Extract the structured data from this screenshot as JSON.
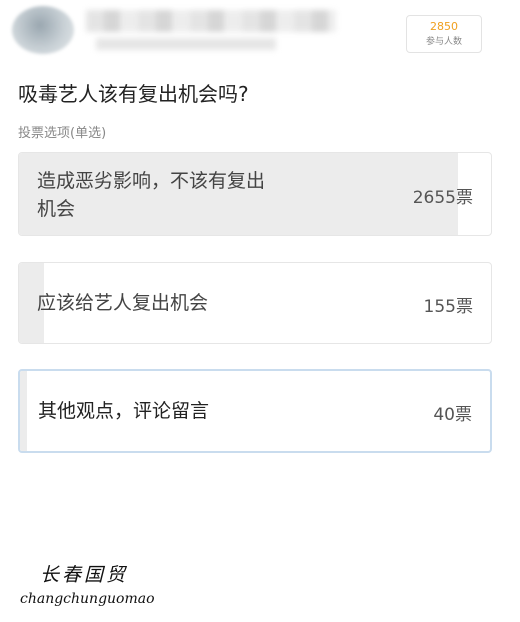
{
  "header": {
    "participants_count": "2850",
    "participants_label": "参与人数"
  },
  "poll": {
    "question": "吸毒艺人该有复出机会吗?",
    "mode_label": "投票选项(单选)",
    "options": [
      {
        "label_line1": "造成恶劣影响，不该有复出",
        "label_line2": "机会",
        "votes": "2655票",
        "share": 0.93
      },
      {
        "label_line1": "应该给艺人复出机会",
        "label_line2": "",
        "votes": "155票",
        "share": 0.054
      },
      {
        "label_line1": "其他观点，评论留言",
        "label_line2": "",
        "votes": "40票",
        "share": 0.014,
        "selected": true
      }
    ]
  },
  "watermark": {
    "cn": "长春国贸",
    "en": "changchunguomao"
  }
}
